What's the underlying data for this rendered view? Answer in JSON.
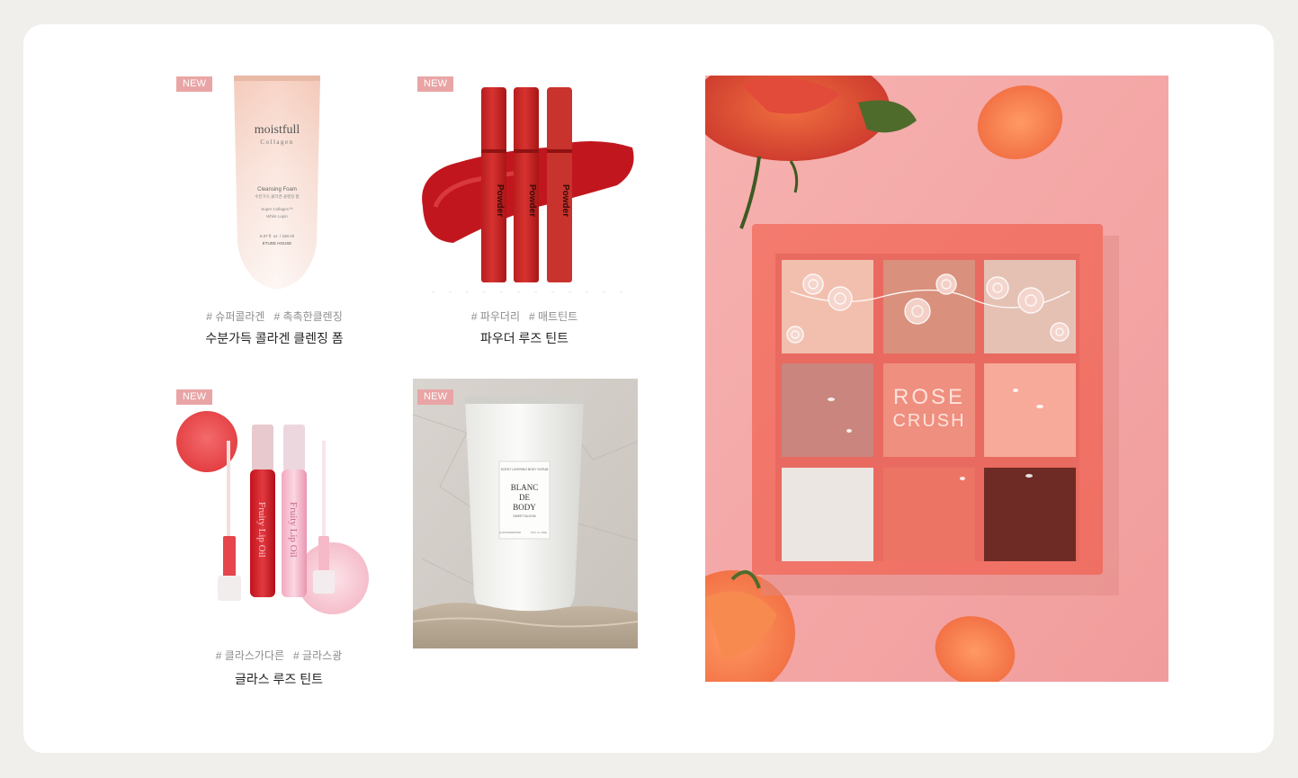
{
  "products": [
    {
      "badge": "NEW",
      "tags": [
        "# 슈퍼콜라겐",
        "# 촉촉한클렌징"
      ],
      "name": "수분가득 콜라겐 클렌징 폼",
      "package_text": {
        "brand": "moistfull",
        "sub": "Collagen",
        "type": "Cleansing Foam",
        "korean": "수분가득 콜라겐 클렌징 폼",
        "line1": "Super Collagen™",
        "line2": "White Lupin",
        "volume": "5.07 fl. oz. / 150 ml",
        "maker": "ETUDE HOUSE"
      }
    },
    {
      "badge": "NEW",
      "tags": [
        "# 파우더리",
        "# 매트틴트"
      ],
      "name": "파우더 루즈 틴트",
      "package_text": {
        "label": "Powder"
      }
    },
    {
      "badge": "NEW",
      "tags": [
        "# 클라스가다른",
        "# 글라스광"
      ],
      "name": "글라스 루즈 틴트",
      "package_text": {
        "label": "Fruity Lip Oil"
      }
    },
    {
      "badge": "NEW",
      "package_text": {
        "top": "SCENT LAYERING BODY SCRUB",
        "line1": "BLANC",
        "line2": "DE",
        "line3": "BODY",
        "sub": "SWEET BLOOM",
        "maker": "by ROUNDAROUND",
        "volume": "6.8 fl. oz / 200g"
      }
    }
  ],
  "feature": {
    "palette_text_1": "ROSE",
    "palette_text_2": "CRUSH"
  }
}
